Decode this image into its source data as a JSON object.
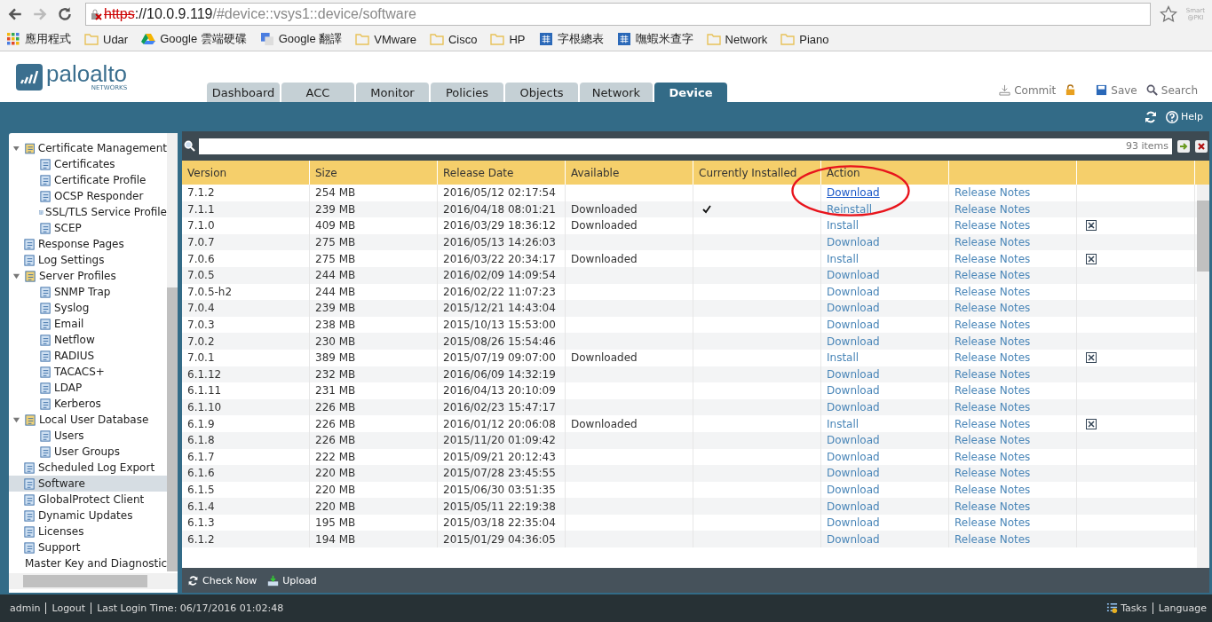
{
  "browser": {
    "address": {
      "scheme": "https",
      "host": "://10.0.9.119",
      "path": "/#device::vsys1::device/software"
    },
    "extension": [
      "Smart",
      "@PKI"
    ],
    "bookmarks": [
      {
        "label": "應用程式",
        "kind": "apps"
      },
      {
        "label": "Udar",
        "kind": "folder"
      },
      {
        "label": "Google 雲端硬碟",
        "kind": "drive"
      },
      {
        "label": "Google 翻譯",
        "kind": "translate"
      },
      {
        "label": "VMware",
        "kind": "folder"
      },
      {
        "label": "Cisco",
        "kind": "folder"
      },
      {
        "label": "HP",
        "kind": "folder"
      },
      {
        "label": "字根總表",
        "kind": "site"
      },
      {
        "label": "嘸蝦米查字",
        "kind": "site"
      },
      {
        "label": "Network",
        "kind": "folder"
      },
      {
        "label": "Piano",
        "kind": "folder"
      }
    ]
  },
  "header": {
    "logo": {
      "name": "paloalto",
      "sub": "NETWORKS"
    },
    "tabs": [
      {
        "label": "Dashboard",
        "selected": false
      },
      {
        "label": "ACC",
        "selected": false
      },
      {
        "label": "Monitor",
        "selected": false
      },
      {
        "label": "Policies",
        "selected": false
      },
      {
        "label": "Objects",
        "selected": false
      },
      {
        "label": "Network",
        "selected": false
      },
      {
        "label": "Device",
        "selected": true
      }
    ],
    "actions": [
      "Commit",
      "Save",
      "Search"
    ],
    "help": "Help"
  },
  "sidebar": {
    "items": [
      {
        "label": "Certificate Management",
        "selected": false,
        "expanded": true,
        "children": [
          {
            "label": "Certificates",
            "selected": false
          },
          {
            "label": "Certificate Profile",
            "selected": false
          },
          {
            "label": "OCSP Responder",
            "selected": false
          },
          {
            "label": "SSL/TLS Service Profile",
            "selected": false
          },
          {
            "label": "SCEP",
            "selected": false
          }
        ]
      },
      {
        "label": "Response Pages",
        "selected": false
      },
      {
        "label": "Log Settings",
        "selected": false
      },
      {
        "label": "Server Profiles",
        "selected": false,
        "expanded": true,
        "children": [
          {
            "label": "SNMP Trap",
            "selected": false
          },
          {
            "label": "Syslog",
            "selected": false
          },
          {
            "label": "Email",
            "selected": false
          },
          {
            "label": "Netflow",
            "selected": false
          },
          {
            "label": "RADIUS",
            "selected": false
          },
          {
            "label": "TACACS+",
            "selected": false
          },
          {
            "label": "LDAP",
            "selected": false
          },
          {
            "label": "Kerberos",
            "selected": false
          }
        ]
      },
      {
        "label": "Local User Database",
        "selected": false,
        "expanded": true,
        "children": [
          {
            "label": "Users",
            "selected": false
          },
          {
            "label": "User Groups",
            "selected": false
          }
        ]
      },
      {
        "label": "Scheduled Log Export",
        "selected": false
      },
      {
        "label": "Software",
        "selected": true
      },
      {
        "label": "GlobalProtect Client",
        "selected": false
      },
      {
        "label": "Dynamic Updates",
        "selected": false
      },
      {
        "label": "Licenses",
        "selected": false
      },
      {
        "label": "Support",
        "selected": false
      },
      {
        "label": "Master Key and Diagnostic",
        "selected": false
      }
    ]
  },
  "table": {
    "count": "93 items",
    "columns": [
      "Version",
      "Size",
      "Release Date",
      "Available",
      "Currently Installed",
      "Action"
    ],
    "rows": [
      {
        "version": "7.1.2",
        "size": "254 MB",
        "date": "2016/05/12 02:17:54",
        "available": "",
        "installed": false,
        "action": "Download",
        "hover": true,
        "notes": "Release Notes",
        "deletable": false
      },
      {
        "version": "7.1.1",
        "size": "239 MB",
        "date": "2016/04/18 08:01:21",
        "available": "Downloaded",
        "installed": true,
        "action": "Reinstall",
        "hover": false,
        "notes": "Release Notes",
        "deletable": false
      },
      {
        "version": "7.1.0",
        "size": "409 MB",
        "date": "2016/03/29 18:36:12",
        "available": "Downloaded",
        "installed": false,
        "action": "Install",
        "hover": false,
        "notes": "Release Notes",
        "deletable": true
      },
      {
        "version": "7.0.7",
        "size": "275 MB",
        "date": "2016/05/13 14:26:03",
        "available": "",
        "installed": false,
        "action": "Download",
        "hover": false,
        "notes": "Release Notes",
        "deletable": false
      },
      {
        "version": "7.0.6",
        "size": "275 MB",
        "date": "2016/03/22 20:34:17",
        "available": "Downloaded",
        "installed": false,
        "action": "Install",
        "hover": false,
        "notes": "Release Notes",
        "deletable": true
      },
      {
        "version": "7.0.5",
        "size": "244 MB",
        "date": "2016/02/09 14:09:54",
        "available": "",
        "installed": false,
        "action": "Download",
        "hover": false,
        "notes": "Release Notes",
        "deletable": false
      },
      {
        "version": "7.0.5-h2",
        "size": "244 MB",
        "date": "2016/02/22 11:07:23",
        "available": "",
        "installed": false,
        "action": "Download",
        "hover": false,
        "notes": "Release Notes",
        "deletable": false
      },
      {
        "version": "7.0.4",
        "size": "239 MB",
        "date": "2015/12/21 14:43:04",
        "available": "",
        "installed": false,
        "action": "Download",
        "hover": false,
        "notes": "Release Notes",
        "deletable": false
      },
      {
        "version": "7.0.3",
        "size": "238 MB",
        "date": "2015/10/13 15:53:00",
        "available": "",
        "installed": false,
        "action": "Download",
        "hover": false,
        "notes": "Release Notes",
        "deletable": false
      },
      {
        "version": "7.0.2",
        "size": "230 MB",
        "date": "2015/08/26 15:54:46",
        "available": "",
        "installed": false,
        "action": "Download",
        "hover": false,
        "notes": "Release Notes",
        "deletable": false
      },
      {
        "version": "7.0.1",
        "size": "389 MB",
        "date": "2015/07/19 09:07:00",
        "available": "Downloaded",
        "installed": false,
        "action": "Install",
        "hover": false,
        "notes": "Release Notes",
        "deletable": true
      },
      {
        "version": "6.1.12",
        "size": "232 MB",
        "date": "2016/06/09 14:32:19",
        "available": "",
        "installed": false,
        "action": "Download",
        "hover": false,
        "notes": "Release Notes",
        "deletable": false
      },
      {
        "version": "6.1.11",
        "size": "231 MB",
        "date": "2016/04/13 20:10:09",
        "available": "",
        "installed": false,
        "action": "Download",
        "hover": false,
        "notes": "Release Notes",
        "deletable": false
      },
      {
        "version": "6.1.10",
        "size": "226 MB",
        "date": "2016/02/23 15:47:17",
        "available": "",
        "installed": false,
        "action": "Download",
        "hover": false,
        "notes": "Release Notes",
        "deletable": false
      },
      {
        "version": "6.1.9",
        "size": "226 MB",
        "date": "2016/01/12 20:06:08",
        "available": "Downloaded",
        "installed": false,
        "action": "Install",
        "hover": false,
        "notes": "Release Notes",
        "deletable": true
      },
      {
        "version": "6.1.8",
        "size": "226 MB",
        "date": "2015/11/20 01:09:42",
        "available": "",
        "installed": false,
        "action": "Download",
        "hover": false,
        "notes": "Release Notes",
        "deletable": false
      },
      {
        "version": "6.1.7",
        "size": "222 MB",
        "date": "2015/09/21 20:12:43",
        "available": "",
        "installed": false,
        "action": "Download",
        "hover": false,
        "notes": "Release Notes",
        "deletable": false
      },
      {
        "version": "6.1.6",
        "size": "220 MB",
        "date": "2015/07/28 23:45:55",
        "available": "",
        "installed": false,
        "action": "Download",
        "hover": false,
        "notes": "Release Notes",
        "deletable": false
      },
      {
        "version": "6.1.5",
        "size": "220 MB",
        "date": "2015/06/30 03:51:35",
        "available": "",
        "installed": false,
        "action": "Download",
        "hover": false,
        "notes": "Release Notes",
        "deletable": false
      },
      {
        "version": "6.1.4",
        "size": "220 MB",
        "date": "2015/05/11 22:19:38",
        "available": "",
        "installed": false,
        "action": "Download",
        "hover": false,
        "notes": "Release Notes",
        "deletable": false
      },
      {
        "version": "6.1.3",
        "size": "195 MB",
        "date": "2015/03/18 22:35:04",
        "available": "",
        "installed": false,
        "action": "Download",
        "hover": false,
        "notes": "Release Notes",
        "deletable": false
      },
      {
        "version": "6.1.2",
        "size": "194 MB",
        "date": "2015/01/29 04:36:05",
        "available": "",
        "installed": false,
        "action": "Download",
        "hover": false,
        "notes": "Release Notes",
        "deletable": false
      }
    ]
  },
  "toolbar": [
    "Check Now",
    "Upload"
  ],
  "footer": {
    "user": "admin",
    "logout": "Logout",
    "last_login": "Last Login Time: 06/17/2016 01:02:48",
    "tasks": "Tasks",
    "language": "Language"
  }
}
